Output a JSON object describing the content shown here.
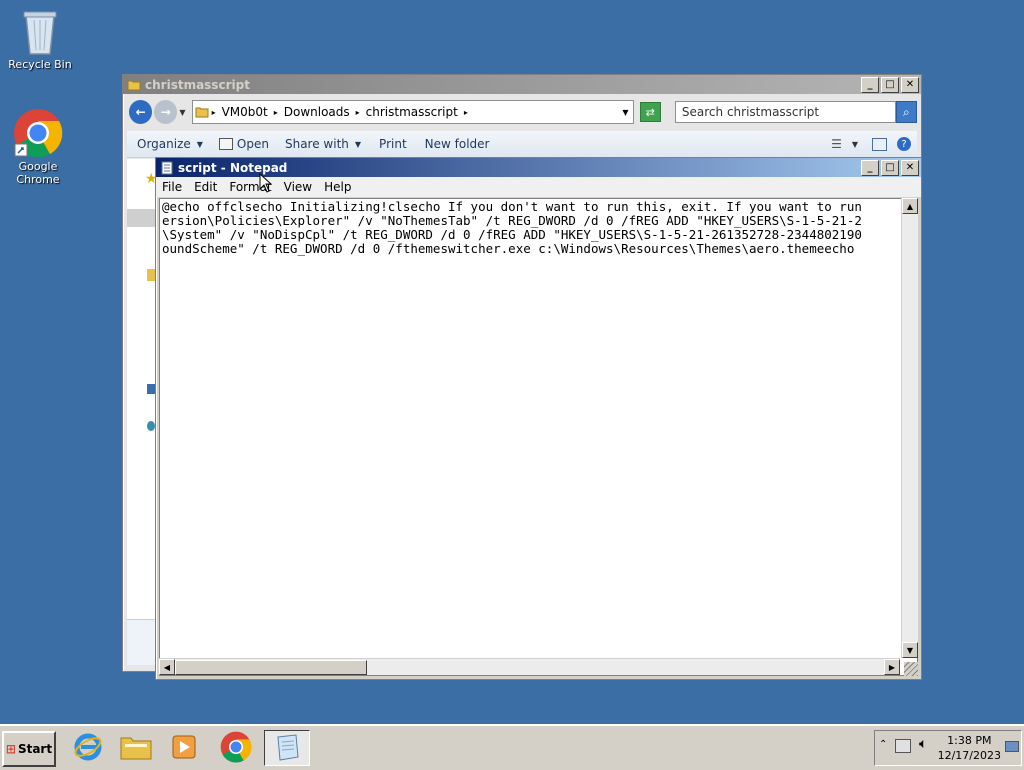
{
  "desktop": {
    "recycle_bin": "Recycle Bin",
    "chrome": "Google Chrome"
  },
  "explorer": {
    "title": "christmasscript",
    "breadcrumbs": [
      "VM0b0t",
      "Downloads",
      "christmasscript"
    ],
    "search_placeholder": "Search christmasscript",
    "toolbar": {
      "organize": "Organize",
      "open": "Open",
      "share_with": "Share with",
      "print": "Print",
      "new_folder": "New folder"
    }
  },
  "notepad": {
    "title": "script - Notepad",
    "menu": [
      "File",
      "Edit",
      "Format",
      "View",
      "Help"
    ],
    "lines": [
      "@echo offclsecho Initializing!clsecho If you don't want to run this, exit. If you want to run",
      "ersion\\Policies\\Explorer\" /v \"NoThemesTab\" /t REG_DWORD /d 0 /fREG ADD \"HKEY_USERS\\S-1-5-21-2",
      "\\System\" /v \"NoDispCpl\" /t REG_DWORD /d 0 /fREG ADD \"HKEY_USERS\\S-1-5-21-261352728-2344802190",
      "oundScheme\" /t REG_DWORD /d 0 /fthemeswitcher.exe c:\\Windows\\Resources\\Themes\\aero.themeecho"
    ]
  },
  "taskbar": {
    "start": "Start",
    "time": "1:38 PM",
    "date": "12/17/2023"
  },
  "colors": {
    "desktop": "#3a6ea5",
    "active_title": "#0a246a"
  }
}
